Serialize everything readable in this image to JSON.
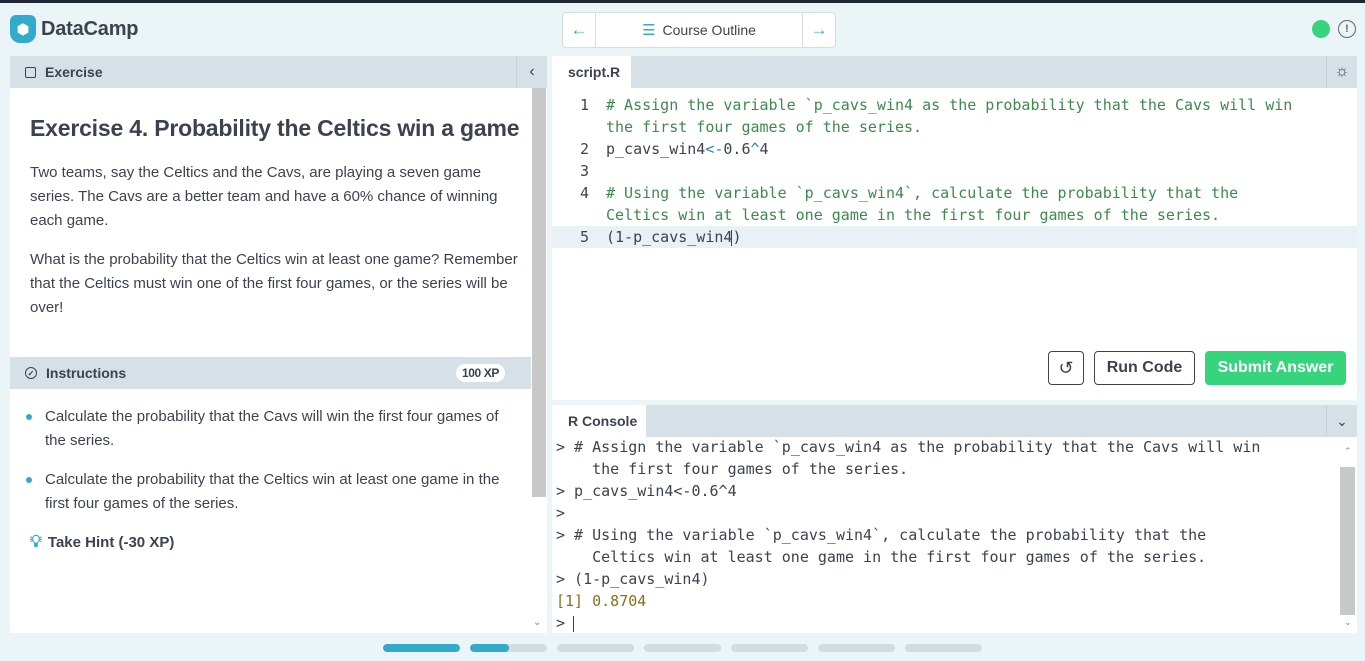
{
  "header": {
    "brand": "DataCamp",
    "nav_label": "Course Outline",
    "prev_icon": "arrow-left-icon",
    "next_icon": "arrow-right-icon",
    "status_color": "#36d57d"
  },
  "exercise_panel": {
    "tab_label": "Exercise",
    "title": "Exercise 4. Probability the Celtics win a game",
    "paragraphs": [
      "Two teams, say the Celtics and the Cavs, are playing a seven game series. The Cavs are a better team and have a 60% chance of winning each game.",
      "What is the probability that the Celtics win at least one game? Remember that the Celtics must win one of the first four games, or the series will be over!"
    ]
  },
  "instructions": {
    "label": "Instructions",
    "xp": "100 XP",
    "items": [
      "Calculate the probability that the Cavs will win the first four games of the series.",
      "Calculate the probability that the Celtics win at least one game in the first four games of the series."
    ],
    "hint_label": "Take Hint (-30 XP)"
  },
  "editor": {
    "tab_label": "script.R",
    "line_numbers": [
      "1",
      "",
      "2",
      "3",
      "4",
      "",
      "5"
    ],
    "lines": [
      "# Assign the variable `p_cavs_win4 as the probability that the Cavs will win",
      "the first four games of the series.",
      "p_cavs_win4",
      "",
      "# Using the variable `p_cavs_win4`, calculate the probability that the",
      "Celtics win at least one game in the first four games of the series.",
      "(1-p_cavs_win4"
    ],
    "line2_op": "<-",
    "line2_num": "0.6",
    "line2_pow": "^",
    "line2_exp": "4",
    "line5_close": ")",
    "run_label": "Run Code",
    "submit_label": "Submit Answer",
    "submit_color": "#36d57d"
  },
  "console": {
    "tab_label": "R Console",
    "lines": [
      "> # Assign the variable `p_cavs_win4 as the probability that the Cavs will win",
      "    the first four games of the series.",
      "> p_cavs_win4<-0.6^4",
      ">",
      "> # Using the variable `p_cavs_win4`, calculate the probability that the",
      "    Celtics win at least one game in the first four games of the series.",
      "> (1-p_cavs_win4)",
      "[1] 0.8704",
      "> "
    ]
  },
  "progress": {
    "segments": [
      1,
      0.5,
      0,
      0,
      0,
      0,
      0
    ],
    "accent": "#33aacc"
  }
}
